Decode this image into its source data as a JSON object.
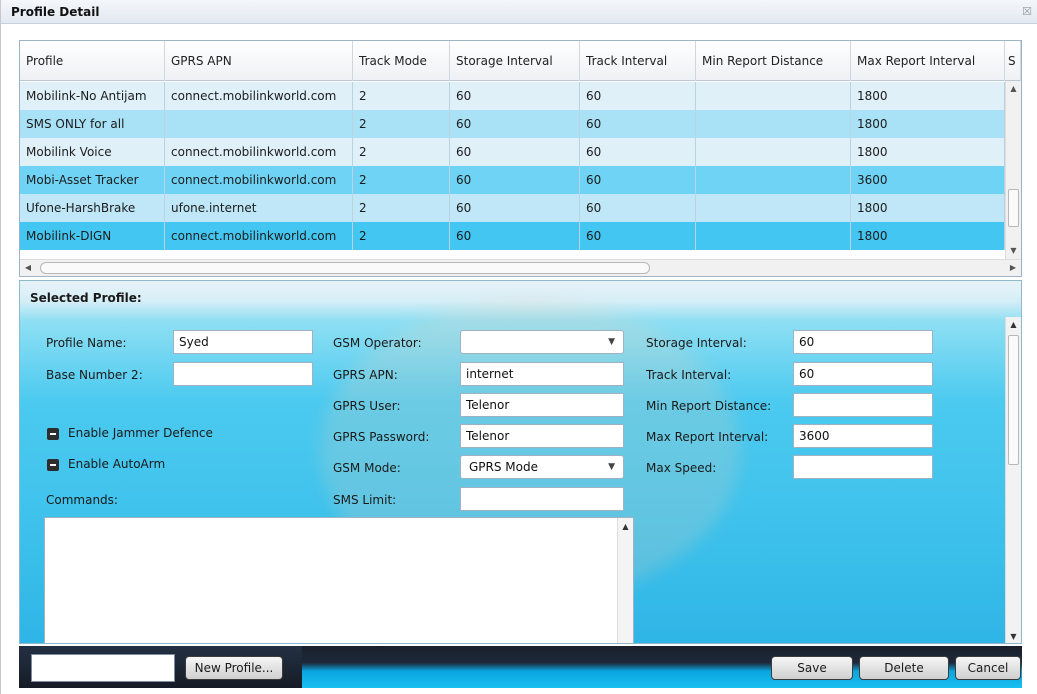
{
  "window": {
    "title": "Profile Detail",
    "close_glyph": "☒"
  },
  "grid": {
    "columns": [
      "Profile",
      "GPRS APN",
      "Track Mode",
      "Storage Interval",
      "Track Interval",
      "Min Report Distance",
      "Max Report Interval",
      "S"
    ],
    "rows": [
      {
        "cells": [
          "Mobilink-No Antijam",
          "connect.mobilinkworld.com",
          "2",
          "60",
          "60",
          "",
          "1800",
          ""
        ]
      },
      {
        "cells": [
          "SMS ONLY for all",
          "",
          "2",
          "60",
          "60",
          "",
          "1800",
          ""
        ]
      },
      {
        "cells": [
          "Mobilink Voice",
          "connect.mobilinkworld.com",
          "2",
          "60",
          "60",
          "",
          "1800",
          ""
        ]
      },
      {
        "cells": [
          "Mobi-Asset Tracker",
          "connect.mobilinkworld.com",
          "2",
          "60",
          "60",
          "",
          "3600",
          ""
        ]
      },
      {
        "cells": [
          "Ufone-HarshBrake",
          "ufone.internet",
          "2",
          "60",
          "60",
          "",
          "1800",
          ""
        ]
      },
      {
        "cells": [
          "Mobilink-DIGN",
          "connect.mobilinkworld.com",
          "2",
          "60",
          "60",
          "",
          "1800",
          ""
        ]
      }
    ]
  },
  "selected_profile": {
    "title": "Selected Profile:",
    "profile_name_label": "Profile Name:",
    "profile_name_value": "Syed",
    "base_number_label": "Base Number 2:",
    "base_number_value": "",
    "jammer_label": "Enable Jammer Defence",
    "autoarm_label": "Enable AutoArm",
    "commands_label": "Commands:",
    "gsm_operator_label": "GSM Operator:",
    "gsm_operator_value": "",
    "gprs_apn_label": "GPRS APN:",
    "gprs_apn_value": "internet",
    "gprs_user_label": "GPRS User:",
    "gprs_user_value": "Telenor",
    "gprs_password_label": "GPRS Password:",
    "gprs_password_value": "Telenor",
    "gsm_mode_label": "GSM Mode:",
    "gsm_mode_value": "GPRS Mode",
    "sms_limit_label": "SMS Limit:",
    "sms_limit_value": "",
    "storage_interval_label": "Storage Interval:",
    "storage_interval_value": "60",
    "track_interval_label": "Track Interval:",
    "track_interval_value": "60",
    "min_report_distance_label": "Min Report Distance:",
    "min_report_distance_value": "",
    "max_report_interval_label": "Max Report Interval:",
    "max_report_interval_value": "3600",
    "max_speed_label": "Max Speed:",
    "max_speed_value": ""
  },
  "footer": {
    "new_profile_input_value": "",
    "new_profile_label": "New Profile...",
    "save_label": "Save",
    "delete_label": "Delete",
    "cancel_label": "Cancel"
  },
  "colors": {
    "row_light": "#dff0f9",
    "row_selected": "#43c7f2",
    "row_alt": "#a9e2f7",
    "panel_accent": "#3ec2ec"
  }
}
